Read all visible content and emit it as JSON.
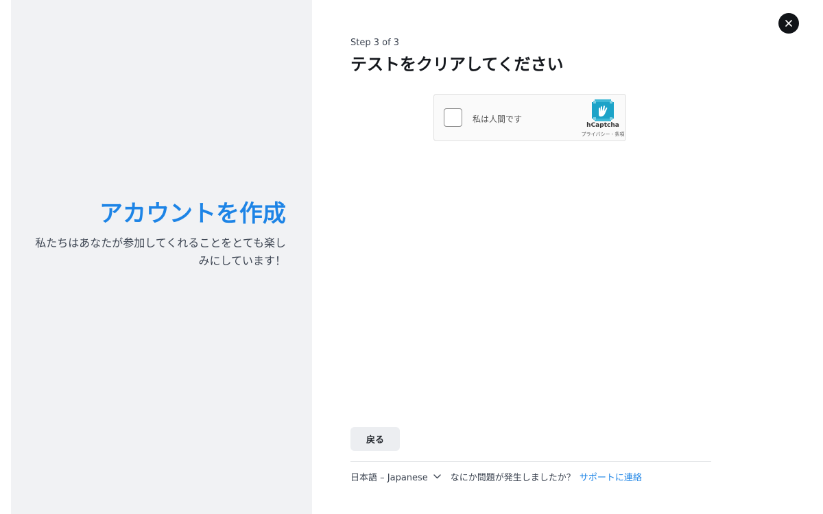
{
  "left": {
    "title": "アカウントを作成",
    "description": "私たちはあなたが参加してくれることをとても楽しみにしています！"
  },
  "header": {
    "step": "Step 3 of 3",
    "title": "テストをクリアしてください"
  },
  "captcha": {
    "label": "私は人間です",
    "brand": "hCaptcha",
    "links": "プライバシー - 条項"
  },
  "actions": {
    "back": "戻る"
  },
  "footer": {
    "language": "日本語 – Japanese",
    "help_text": "なにか問題が発生しましたか？",
    "support_link": "サポートに連絡"
  },
  "colors": {
    "accent": "#1d84e6",
    "left_panel": "#f1f2f4",
    "close_button": "#111418",
    "captcha_logo": "#1ca3c8"
  },
  "icons": {
    "close": "close-icon",
    "captcha_logo": "hcaptcha-logo-icon",
    "language_chevron": "chevron-down-icon"
  }
}
